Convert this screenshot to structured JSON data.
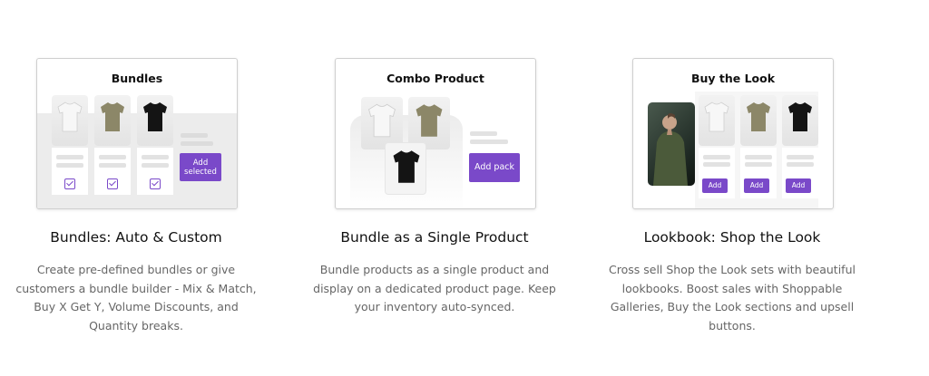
{
  "features": [
    {
      "card_title": "Bundles",
      "card_button": "Add selected",
      "title": "Bundles: Auto & Custom",
      "description": "Create pre-defined bundles or give customers a bundle builder - Mix & Match, Buy X Get Y, Volume Discounts, and Quantity breaks."
    },
    {
      "card_title": "Combo Product",
      "card_button": "Add pack",
      "title": "Bundle as a Single Product",
      "description": "Bundle products as a single product and display on a dedicated product page. Keep your inventory auto-synced."
    },
    {
      "card_title": "Buy the Look",
      "card_button": "Add",
      "title": "Lookbook: Shop the Look",
      "description": "Cross sell Shop the Look sets with beautiful lookbooks. Boost sales with Shoppable Galleries, Buy the Look sections and upsell buttons."
    }
  ],
  "colors": {
    "accent": "#7a49c9",
    "shirt_white": "#f7f7f7",
    "shirt_olive": "#8c8768",
    "shirt_black": "#141414"
  }
}
